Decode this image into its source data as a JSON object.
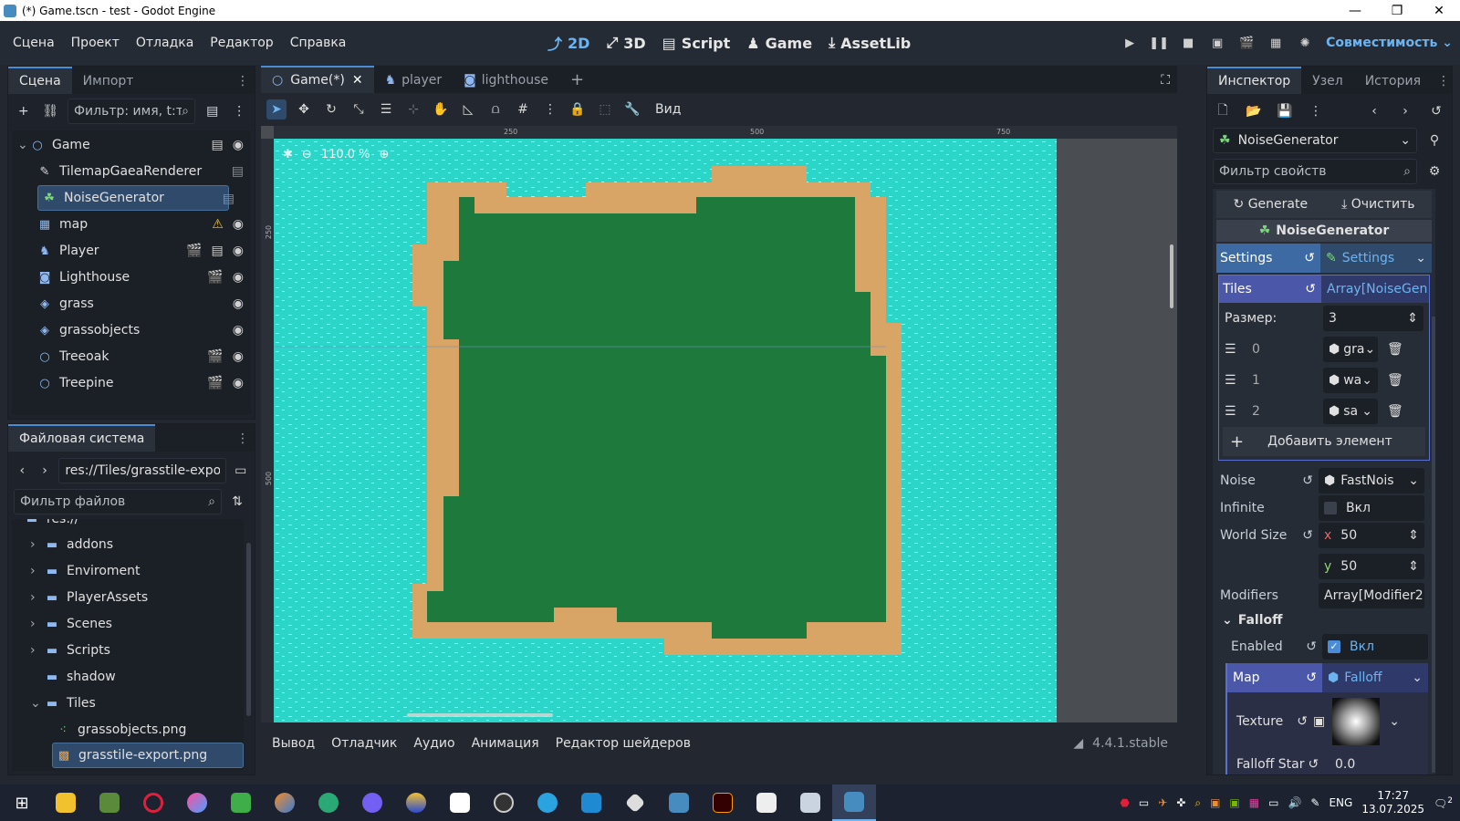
{
  "window": {
    "title": "(*) Game.tscn - test - Godot Engine",
    "min": "—",
    "max": "❐",
    "close": "✕"
  },
  "menu": [
    "Сцена",
    "Проект",
    "Отладка",
    "Редактор",
    "Справка"
  ],
  "modes": [
    {
      "label": "2D",
      "icon": "2d-icon"
    },
    {
      "label": "3D",
      "icon": "3d-icon"
    },
    {
      "label": "Script",
      "icon": "script-icon"
    },
    {
      "label": "Game",
      "icon": "game-icon"
    },
    {
      "label": "AssetLib",
      "icon": "assetlib-icon"
    }
  ],
  "renderer": "Совместимость",
  "scene_panel": {
    "tabs": [
      "Сцена",
      "Импорт"
    ],
    "filter_placeholder": "Фильтр: имя, t:т",
    "nodes": [
      {
        "name": "Game",
        "icon": "node2d-icon"
      },
      {
        "name": "TilemapGaeaRenderer",
        "icon": "brush-icon"
      },
      {
        "name": "NoiseGenerator",
        "icon": "generator-icon"
      },
      {
        "name": "map",
        "icon": "tilemap-icon"
      },
      {
        "name": "Player",
        "icon": "character-icon"
      },
      {
        "name": "Lighthouse",
        "icon": "instance-icon"
      },
      {
        "name": "grass",
        "icon": "tilemap-layer-icon"
      },
      {
        "name": "grassobjects",
        "icon": "tilemap-layer-icon"
      },
      {
        "name": "Treeoak",
        "icon": "node2d-icon"
      },
      {
        "name": "Treepine",
        "icon": "node2d-icon"
      }
    ]
  },
  "fs_panel": {
    "title": "Файловая система",
    "path": "res://Tiles/grasstile-export.",
    "filter_placeholder": "Фильтр файлов",
    "root": "res://",
    "items": [
      "addons",
      "Enviroment",
      "PlayerAssets",
      "Scenes",
      "Scripts",
      "shadow",
      "Tiles",
      "grassobjects.png",
      "grasstile-export.png"
    ]
  },
  "editor_tabs": [
    "Game(*)",
    "player",
    "lighthouse"
  ],
  "toolbar": {
    "view_label": "Вид"
  },
  "zoom": "110.0 %",
  "ruler": [
    "250",
    "500",
    "750"
  ],
  "ruler_v": [
    "250",
    "500"
  ],
  "bottom_tabs": [
    "Вывод",
    "Отладчик",
    "Аудио",
    "Анимация",
    "Редактор шейдеров"
  ],
  "version": "4.4.1.stable",
  "inspector": {
    "tabs": [
      "Инспектор",
      "Узел",
      "История"
    ],
    "node": "NoiseGenerator",
    "filter_placeholder": "Фильтр свойств",
    "generate": "Generate",
    "clear": "Очистить",
    "header": "NoiseGenerator",
    "settings_label": "Settings",
    "settings_value": "Settings",
    "tiles_label": "Tiles",
    "tiles_value": "Array[NoiseGen",
    "size_label": "Размер:",
    "size_value": "3",
    "array_items": [
      {
        "index": "0",
        "value": "gra"
      },
      {
        "index": "1",
        "value": "wa"
      },
      {
        "index": "2",
        "value": "sa"
      }
    ],
    "add_element": "Добавить элемент",
    "noise_label": "Noise",
    "noise_value": "FastNois",
    "infinite_label": "Infinite",
    "on_label": "Вкл",
    "world_size_label": "World Size",
    "x_label": "x",
    "x_value": "50",
    "y_label": "y",
    "y_value": "50",
    "modifiers_label": "Modifiers",
    "modifiers_value": "Array[Modifier2",
    "falloff_section": "Falloff",
    "enabled_label": "Enabled",
    "map_label": "Map",
    "map_value": "Falloff",
    "texture_label": "Texture",
    "falloff_start_label": "Falloff Star",
    "falloff_start_value": "0.0"
  },
  "taskbar": {
    "lang": "ENG",
    "time": "17:27",
    "date": "13.07.2025",
    "notif": "2"
  },
  "colors": {
    "water": "#2bd6c9",
    "sand": "#d9a566",
    "grass": "#1d7a3c",
    "accent": "#6cb4f0"
  }
}
